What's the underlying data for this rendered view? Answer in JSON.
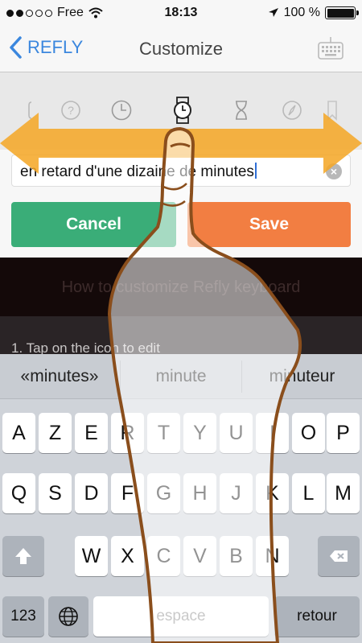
{
  "status": {
    "carrier": "Free",
    "time": "18:13",
    "battery": "100 %"
  },
  "nav": {
    "back_label": "REFLY",
    "title": "Customize"
  },
  "icon_strip": [
    "phone-icon",
    "question-icon",
    "clock-icon",
    "watch-icon",
    "hourglass-icon",
    "compass-icon",
    "bookmark-icon"
  ],
  "field": {
    "value": "en retard d'une dizaine de minutes"
  },
  "buttons": {
    "cancel": "Cancel",
    "save": "Save"
  },
  "help": {
    "heading": "How to customize Refly keyboard",
    "step": "1. Tap on the icon to edit"
  },
  "keyboard": {
    "suggestions": [
      "«minutes»",
      "minute",
      "minuteur"
    ],
    "row1": [
      "A",
      "Z",
      "E",
      "R",
      "T",
      "Y",
      "U",
      "I",
      "O",
      "P"
    ],
    "row2": [
      "Q",
      "S",
      "D",
      "F",
      "G",
      "H",
      "J",
      "K",
      "L",
      "M"
    ],
    "row3": [
      "W",
      "X",
      "C",
      "V",
      "B",
      "N"
    ],
    "numbers_label": "123",
    "space_label": "espace",
    "return_label": "retour"
  },
  "colors": {
    "accent": "#3b87de",
    "cancel": "#3aad78",
    "save": "#f27e42",
    "arrow": "#f5a623"
  }
}
